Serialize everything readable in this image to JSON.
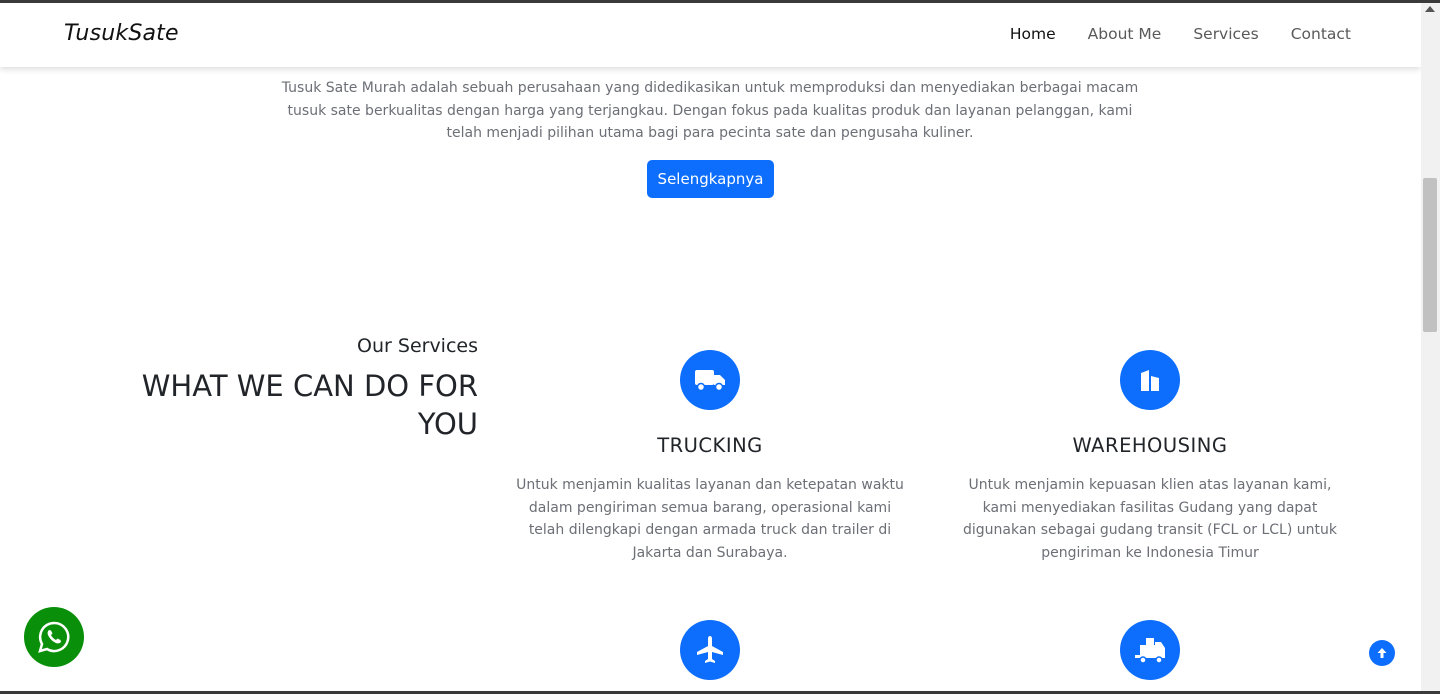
{
  "navbar": {
    "brand": "TusukSate",
    "links": [
      "Home",
      "About Me",
      "Services",
      "Contact"
    ],
    "active": "Home"
  },
  "intro": {
    "text": "Tusuk Sate Murah adalah sebuah perusahaan yang didedikasikan untuk memproduksi dan menyediakan berbagai macam tusuk sate berkualitas dengan harga yang terjangkau. Dengan fokus pada kualitas produk dan layanan pelanggan, kami telah menjadi pilihan utama bagi para pecinta sate dan pengusaha kuliner.",
    "button_label": "Selengkapnya"
  },
  "services": {
    "subtitle": "Our Services",
    "heading": "WHAT WE CAN DO FOR YOU",
    "items": [
      {
        "icon": "truck-icon",
        "title": "TRUCKING",
        "desc": "Untuk menjamin kualitas layanan dan ketepatan waktu dalam pengiriman semua barang, operasional kami telah dilengkapi dengan armada truck dan trailer di Jakarta dan Surabaya."
      },
      {
        "icon": "building-icon",
        "title": "WAREHOUSING",
        "desc": "Untuk menjamin kepuasan klien atas layanan kami, kami menyediakan fasilitas Gudang yang dapat digunakan sebagai gudang transit (FCL or LCL) untuk pengiriman ke Indonesia Timur"
      },
      {
        "icon": "airplane-icon",
        "title": "",
        "desc": ""
      },
      {
        "icon": "truck-ramp-icon",
        "title": "",
        "desc": ""
      }
    ]
  },
  "colors": {
    "primary": "#0d6efd",
    "whatsapp": "#0a8f0a",
    "text_muted": "#6c6f76",
    "text_dark": "#212529"
  }
}
